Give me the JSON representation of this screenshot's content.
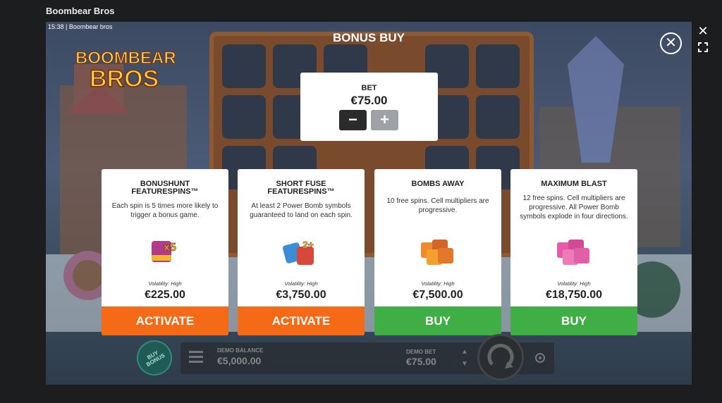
{
  "window": {
    "title": "Boombear Bros"
  },
  "game": {
    "time": "15:38",
    "title": "Boombear bros"
  },
  "logo": {
    "line1": "BOOMBEAR",
    "line2": "BROS"
  },
  "modal": {
    "title": "BONUS BUY",
    "bet": {
      "label": "BET",
      "value": "€75.00",
      "minus": "−",
      "plus": "+"
    },
    "cards": [
      {
        "title": "BONUSHUNT FEATURESPINS™",
        "description": "Each spin is 5 times more likely to trigger a bonus game.",
        "icon": "scatter-x5-icon",
        "volatility": "Volatility: High",
        "price": "€225.00",
        "button": "ACTIVATE",
        "button_color": "#f46a16"
      },
      {
        "title": "SHORT FUSE FEATURESPINS™",
        "description": "At least 2 Power Bomb symbols guaranteed to land on each spin.",
        "icon": "power-bomb-2plus-icon",
        "volatility": "Volatility: High",
        "price": "€3,750.00",
        "button": "ACTIVATE",
        "button_color": "#f46a16"
      },
      {
        "title": "BOMBS AWAY",
        "description": "10 free spins. Cell multipliers are progressive.",
        "icon": "scatter-stack-icon",
        "volatility": "Volatility: High",
        "price": "€7,500.00",
        "button": "BUY",
        "button_color": "#3fae45"
      },
      {
        "title": "MAXIMUM BLAST",
        "description": "12 free spins. Cell multipliers are progressive. All Power Bomb symbols explode in four directions.",
        "icon": "scatter-stack-pink-icon",
        "volatility": "Volatility: High",
        "price": "€18,750.00",
        "button": "BUY",
        "button_color": "#3fae45"
      }
    ]
  },
  "hud": {
    "buy_bonus": "BUY BONUS",
    "balance_label": "DEMO BALANCE",
    "balance_value": "€5,000.00",
    "bet_label": "DEMO BET",
    "bet_value": "€75.00"
  }
}
